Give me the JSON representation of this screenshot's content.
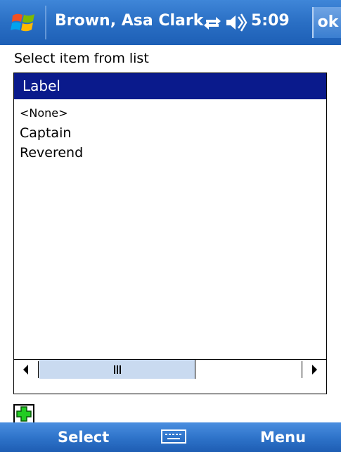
{
  "titlebar": {
    "app_title": "Brown, Asa Clark",
    "clock": "5:09",
    "ok_label": "ok",
    "icons": [
      "windows-start-flag-icon",
      "connectivity-icon",
      "volume-icon"
    ]
  },
  "prompt": "Select item from list",
  "list": {
    "header": "Label",
    "items": [
      "<None>",
      "Captain",
      "Reverend"
    ]
  },
  "softkeys": {
    "left": "Select",
    "right": "Menu",
    "center_icon": "keyboard-icon"
  },
  "colors": {
    "titlebar_blue": "#2a6fc4",
    "header_navy": "#0a1a8c",
    "add_green": "#22cc22"
  }
}
